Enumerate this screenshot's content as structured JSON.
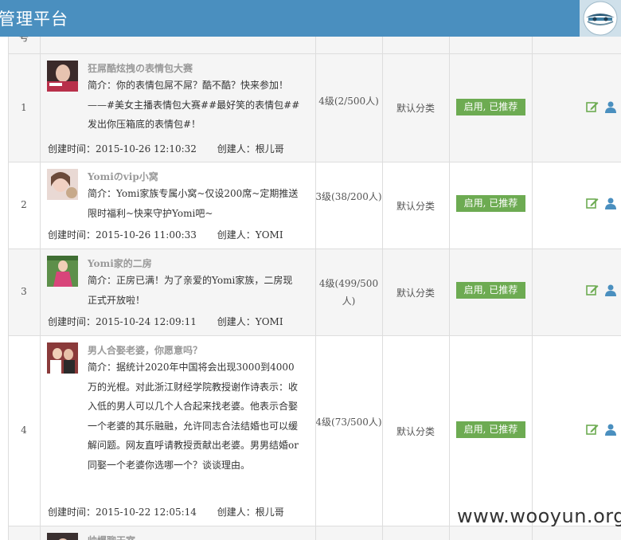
{
  "header": {
    "title": "管理平台"
  },
  "table": {
    "num_header_fragment": "号",
    "rows": [
      {
        "num": "1",
        "name": "狂屌酷炫拽の表情包大赛",
        "intro": "简介：你的表情包屌不屌？酷不酷？快来参加！——#美女主播表情包大赛##最好笑的表情包##发出你压箱底的表情包#！",
        "created_label": "创建时间：",
        "created_time": "2015-10-26 12:10:32",
        "creator_label": "创建人：",
        "creator": "根儿哥",
        "level": "4级(2/500人)",
        "category": "默认分类",
        "status": "启用, 已推荐"
      },
      {
        "num": "2",
        "name": "Yomiのvip小窝",
        "intro": "简介：Yomi家族专属小窝~仅设200席~定期推送限时福利~快来守护Yomi吧~",
        "created_label": "创建时间：",
        "created_time": "2015-10-26 11:00:33",
        "creator_label": "创建人：",
        "creator": "YOMI",
        "level": "3级(38/200人)",
        "category": "默认分类",
        "status": "启用, 已推荐"
      },
      {
        "num": "3",
        "name": "Yomi家的二房",
        "intro": "简介：正房已满！为了亲爱的Yomi家族，二房现正式开放啦！",
        "created_label": "创建时间：",
        "created_time": "2015-10-24 12:09:11",
        "creator_label": "创建人：",
        "creator": "YOMI",
        "level": "4级(499/500人)",
        "category": "默认分类",
        "status": "启用, 已推荐"
      },
      {
        "num": "4",
        "name": "男人合娶老婆，你愿意吗？",
        "intro": "简介：据统计2020年中国将会出现3000到4000万的光棍。对此浙江财经学院教授谢作诗表示：收入低的男人可以几个人合起来找老婆。他表示合娶一个老婆的其乐融融，允许同志合法结婚也可以缓解问题。网友直呼请教授贡献出老婆。男男结婚or同娶一个老婆你选哪一个？谈谈理由。",
        "created_label": "创建时间：",
        "created_time": "2015-10-22 12:05:14",
        "creator_label": "创建人：",
        "creator": "根儿哥",
        "level": "4级(73/500人)",
        "category": "默认分类",
        "status": "启用, 已推荐"
      },
      {
        "num": "",
        "name": "帅爆聊天室",
        "intro": "",
        "created_label": "",
        "created_time": "",
        "creator_label": "",
        "creator": "",
        "level": "",
        "category": "",
        "status": ""
      }
    ]
  },
  "icons": {
    "edit": "edit-icon",
    "user": "user-icon",
    "lock": "lock-icon"
  },
  "colors": {
    "header_bg": "#4a8fbf",
    "status_bg": "#6dab52",
    "edit": "#6dab52",
    "user": "#4a8fbf",
    "lock": "#d9534f"
  },
  "watermark": "www.wooyun.org"
}
